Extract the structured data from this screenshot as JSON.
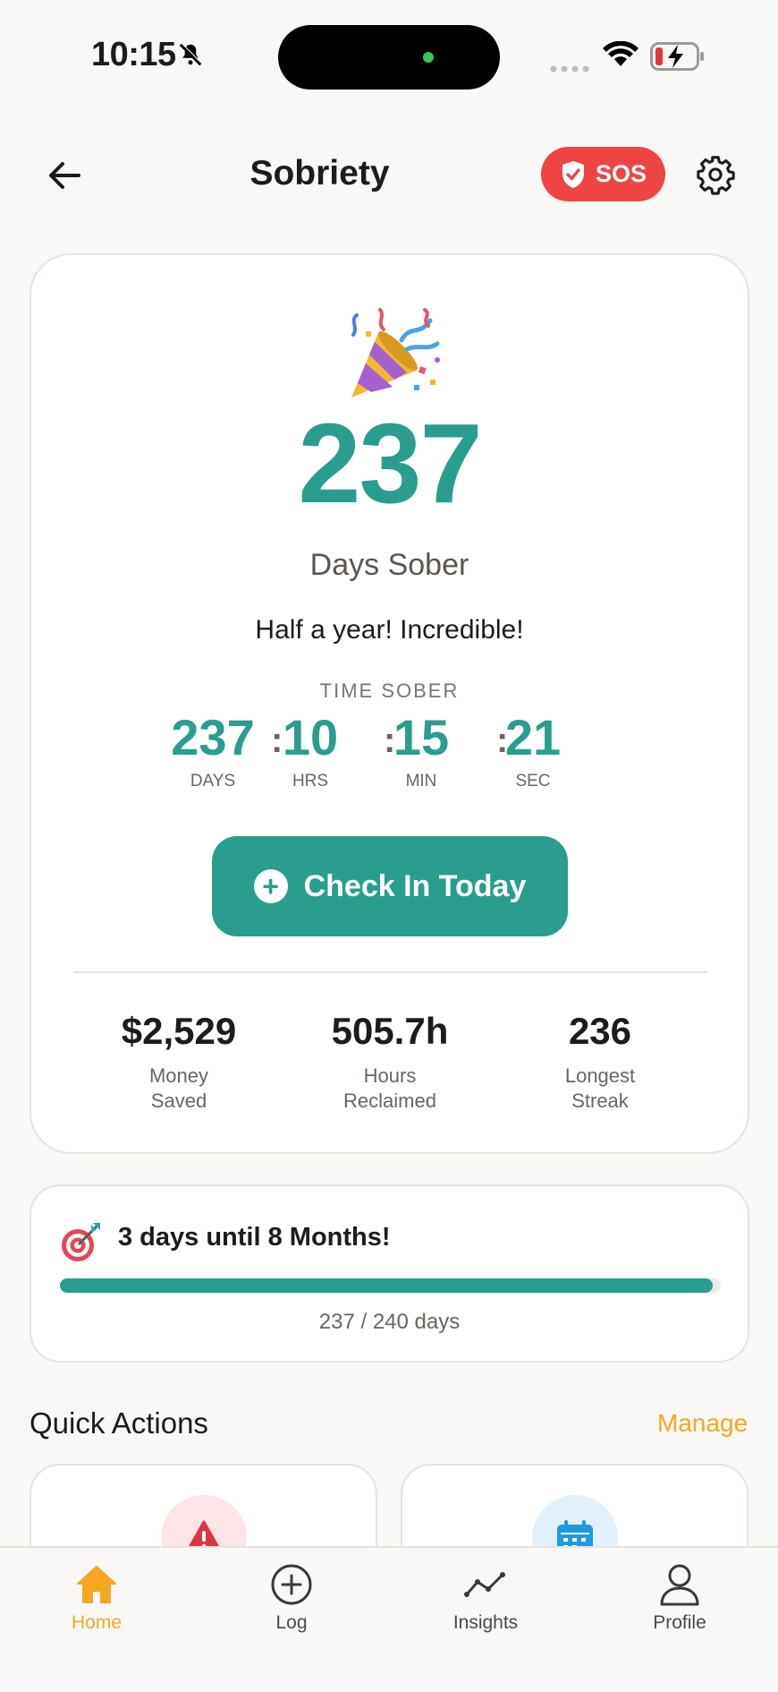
{
  "status_bar": {
    "time": "10:15"
  },
  "header": {
    "title": "Sobriety",
    "sos_label": "SOS"
  },
  "hero": {
    "days": "237",
    "days_label": "Days Sober",
    "message": "Half a year! Incredible!",
    "time_sober_label": "TIME SOBER",
    "timer": {
      "days": "237",
      "days_cap": "DAYS",
      "hrs": "10",
      "hrs_cap": "HRS",
      "min": "15",
      "min_cap": "MIN",
      "sec": "21",
      "sec_cap": "SEC",
      "separator": ":"
    },
    "checkin_label": "Check In Today",
    "stats": [
      {
        "value": "$2,529",
        "label_line1": "Money",
        "label_line2": "Saved"
      },
      {
        "value": "505.7h",
        "label_line1": "Hours",
        "label_line2": "Reclaimed"
      },
      {
        "value": "236",
        "label_line1": "Longest",
        "label_line2": "Streak"
      }
    ]
  },
  "goal": {
    "text": "3 days until 8 Months!",
    "progress_text": "237 / 240 days",
    "progress_fraction": 0.9875
  },
  "quick_actions": {
    "title": "Quick Actions",
    "manage_label": "Manage",
    "items": [
      {
        "icon": "warning-icon",
        "color": "#dc3545",
        "bg": "#fde4e6"
      },
      {
        "icon": "calendar-icon",
        "color": "#1e9be0",
        "bg": "#e1f1fb"
      }
    ]
  },
  "tabs": [
    {
      "label": "Home",
      "icon": "home-icon",
      "active": true
    },
    {
      "label": "Log",
      "icon": "plus-circle-icon",
      "active": false
    },
    {
      "label": "Insights",
      "icon": "chart-line-icon",
      "active": false
    },
    {
      "label": "Profile",
      "icon": "person-icon",
      "active": false
    }
  ],
  "colors": {
    "accent": "#2a9d8f",
    "sos": "#ef4444",
    "tab_active": "#f5a623",
    "manage": "#f5a623"
  }
}
